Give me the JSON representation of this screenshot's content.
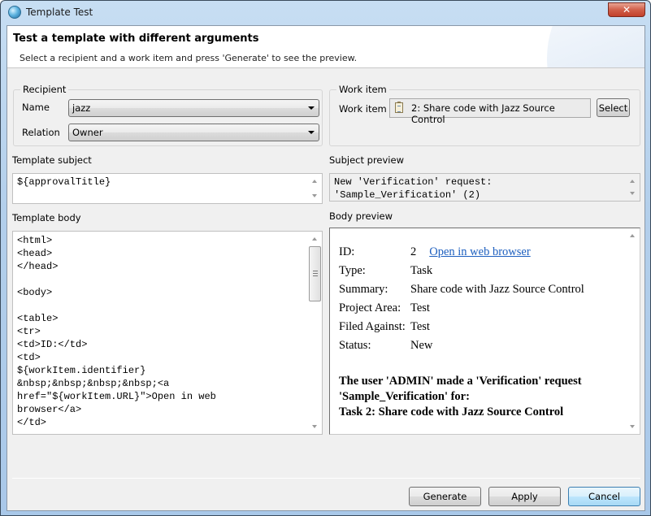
{
  "window": {
    "title": "Template Test",
    "close_label": "✕"
  },
  "header": {
    "title": "Test a template with different arguments",
    "description": "Select a recipient and a work item and press 'Generate' to see the preview."
  },
  "recipient": {
    "group_label": "Recipient",
    "name_label": "Name",
    "name_value": "jazz",
    "relation_label": "Relation",
    "relation_value": "Owner"
  },
  "work_item": {
    "group_label": "Work item",
    "field_label": "Work item",
    "value": "2: Share code with Jazz Source Control",
    "icon": "clipboard-icon",
    "select_label": "Select"
  },
  "template_subject": {
    "label": "Template subject",
    "value": "${approvalTitle}"
  },
  "template_body": {
    "label": "Template body",
    "lines": [
      "<html>",
      "<head>",
      "</head>",
      "",
      "<body>",
      "",
      "<table>",
      "<tr>",
      "<td>ID:</td>",
      "<td>",
      "${workItem.identifier}",
      "&nbsp;&nbsp;&nbsp;&nbsp;<a",
      "href=\"${workItem.URL}\">Open in web",
      "browser</a>",
      "</td>"
    ]
  },
  "subject_preview": {
    "label": "Subject preview",
    "lines": [
      "New 'Verification' request:",
      "'Sample_Verification' (2)"
    ]
  },
  "body_preview": {
    "label": "Body preview",
    "rows": [
      {
        "key": "ID:",
        "value": "2",
        "link": "Open in web browser"
      },
      {
        "key": "Type:",
        "value": "Task"
      },
      {
        "key": "Summary:",
        "value": "Share code with Jazz Source Control"
      },
      {
        "key": "Project Area:",
        "value": "Test"
      },
      {
        "key": "Filed Against:",
        "value": "Test"
      },
      {
        "key": "Status:",
        "value": "New"
      }
    ],
    "message_lines": [
      "The user 'ADMIN' made a 'Verification' request",
      "'Sample_Verification' for:",
      "Task 2: Share code with Jazz Source Control"
    ],
    "link_color": "#1d5fbf"
  },
  "buttons": {
    "generate": "Generate",
    "apply": "Apply",
    "cancel": "Cancel"
  }
}
